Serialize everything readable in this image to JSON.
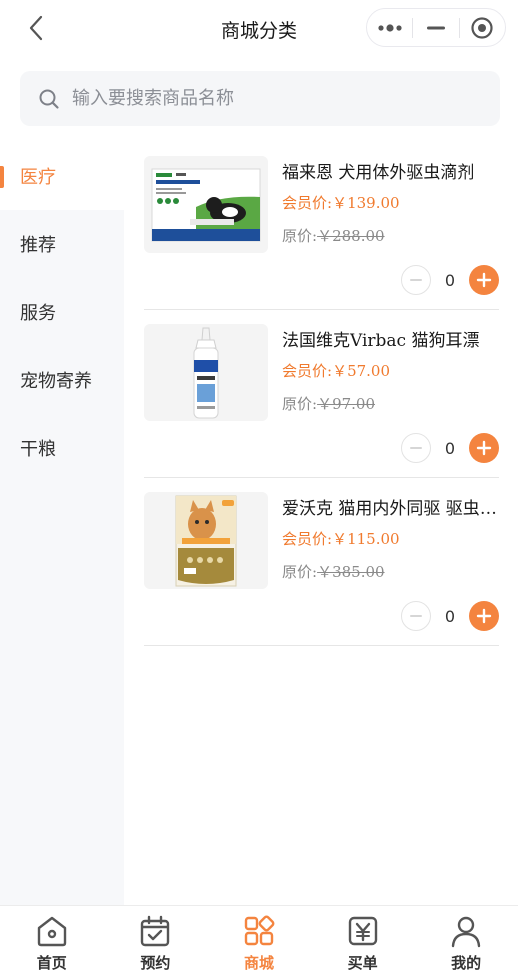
{
  "header": {
    "title": "商城分类",
    "back_icon": "chevron-left-icon",
    "capsule": [
      "more-dots-icon",
      "minimize-icon",
      "target-circle-icon"
    ]
  },
  "search": {
    "placeholder": "输入要搜索商品名称",
    "icon": "search-icon"
  },
  "sidebar": {
    "items": [
      {
        "label": "医疗",
        "active": true
      },
      {
        "label": "推荐"
      },
      {
        "label": "服务"
      },
      {
        "label": "宠物寄养"
      },
      {
        "label": "干粮"
      }
    ]
  },
  "products": [
    {
      "name": "福来恩 犬用体外驱虫滴剂",
      "member_label": "会员价:",
      "member_price": "￥139.00",
      "orig_label": "原价:",
      "orig_price": "￥288.00",
      "qty": "0"
    },
    {
      "name": "法国维克Virbac 猫狗耳漂",
      "member_label": "会员价:",
      "member_price": "￥57.00",
      "orig_label": "原价:",
      "orig_price": "￥97.00",
      "qty": "0"
    },
    {
      "name": "爱沃克 猫用内外同驱 驱虫滴剂",
      "member_label": "会员价:",
      "member_price": "￥115.00",
      "orig_label": "原价:",
      "orig_price": "￥385.00",
      "qty": "0"
    }
  ],
  "tabbar": {
    "items": [
      {
        "label": "首页",
        "icon": "home-icon"
      },
      {
        "label": "预约",
        "icon": "calendar-check-icon"
      },
      {
        "label": "商城",
        "icon": "grid-apps-icon",
        "active": true
      },
      {
        "label": "买单",
        "icon": "yen-bill-icon"
      },
      {
        "label": "我的",
        "icon": "user-icon"
      }
    ]
  },
  "colors": {
    "accent": "#f4843f",
    "sidebar_bg": "#f7f8fa",
    "search_bg": "#f5f6f8"
  }
}
